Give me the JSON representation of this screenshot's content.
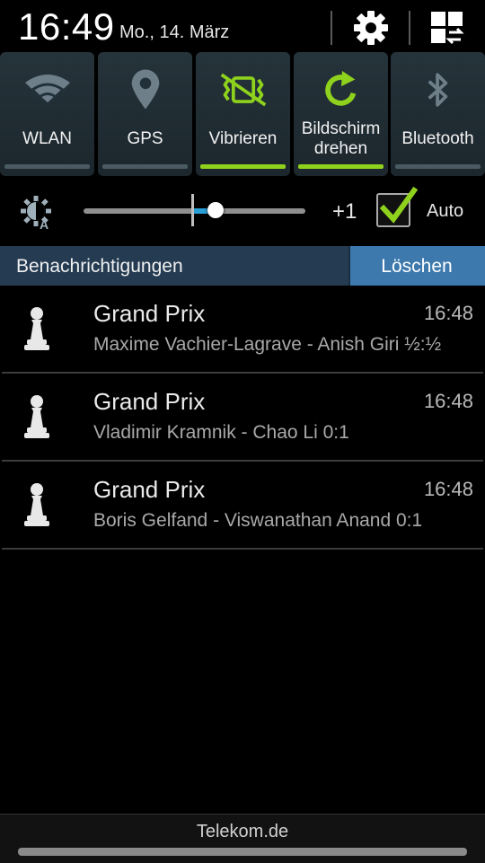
{
  "status": {
    "time": "16:49",
    "date": "Mo., 14. März"
  },
  "header_icons": [
    "gear-icon",
    "grid-toggle-icon"
  ],
  "toggles": [
    {
      "label": "WLAN",
      "icon": "wifi-icon",
      "active": false
    },
    {
      "label": "GPS",
      "icon": "location-pin-icon",
      "active": false
    },
    {
      "label": "Vibrieren",
      "icon": "vibrate-icon",
      "active": true
    },
    {
      "label": "Bildschirm drehen",
      "icon": "rotate-icon",
      "active": true
    },
    {
      "label": "Bluetooth",
      "icon": "bluetooth-icon",
      "active": false
    }
  ],
  "brightness": {
    "level_label": "+1",
    "auto_label": "Auto",
    "auto_checked": true,
    "level_fraction": 0.59
  },
  "notifications_header": {
    "title": "Benachrichtigungen",
    "clear_label": "Löschen"
  },
  "notifications": [
    {
      "title": "Grand Prix",
      "time": "16:48",
      "text": "Maxime Vachier-Lagrave - Anish Giri ½:½",
      "icon": "chess-pawn-icon"
    },
    {
      "title": "Grand Prix",
      "time": "16:48",
      "text": "Vladimir Kramnik - Chao Li 0:1",
      "icon": "chess-pawn-icon"
    },
    {
      "title": "Grand Prix",
      "time": "16:48",
      "text": "Boris Gelfand - Viswanathan Anand 0:1",
      "icon": "chess-pawn-icon"
    }
  ],
  "footer": {
    "carrier": "Telekom.de"
  },
  "colors": {
    "accent_green": "#8fd21d",
    "slider_blue": "#2a9fd6",
    "clear_button": "#3d79ad",
    "notif_header": "#243b52"
  }
}
